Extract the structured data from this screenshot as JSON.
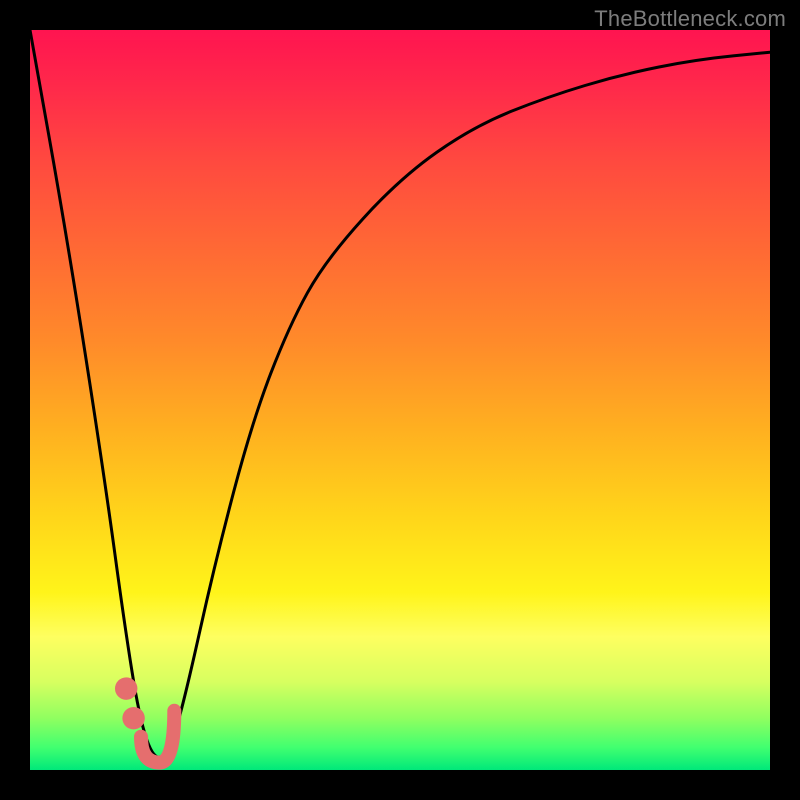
{
  "watermark": "TheBottleneck.com",
  "colors": {
    "background": "#000000",
    "curve": "#000000",
    "marker": "#e56e6e",
    "gradient_top": "#ff1450",
    "gradient_bottom": "#00e87a"
  },
  "chart_data": {
    "type": "line",
    "title": "",
    "xlabel": "",
    "ylabel": "",
    "xlim": [
      0,
      100
    ],
    "ylim": [
      0,
      100
    ],
    "grid": false,
    "series": [
      {
        "name": "bottleneck-curve",
        "x": [
          0,
          5,
          10,
          13,
          15,
          17,
          19,
          21,
          25,
          30,
          35,
          40,
          50,
          60,
          70,
          80,
          90,
          100
        ],
        "y": [
          100,
          72,
          40,
          18,
          6,
          1,
          3,
          10,
          28,
          47,
          60,
          69,
          80,
          87,
          91,
          94,
          96,
          97
        ]
      }
    ],
    "markers": [
      {
        "name": "dot-upper",
        "x": 13.0,
        "y": 11.0,
        "r": 1.5
      },
      {
        "name": "dot-lower",
        "x": 14.0,
        "y": 7.0,
        "r": 1.5
      },
      {
        "name": "hook-tl",
        "x": 15.0,
        "y": 4.5
      },
      {
        "name": "hook-bottom",
        "x": 17.5,
        "y": 1.0
      },
      {
        "name": "hook-tr",
        "x": 19.5,
        "y": 8.0
      }
    ],
    "marker_color": "#e56e6e",
    "marker_stroke_width": 14
  }
}
